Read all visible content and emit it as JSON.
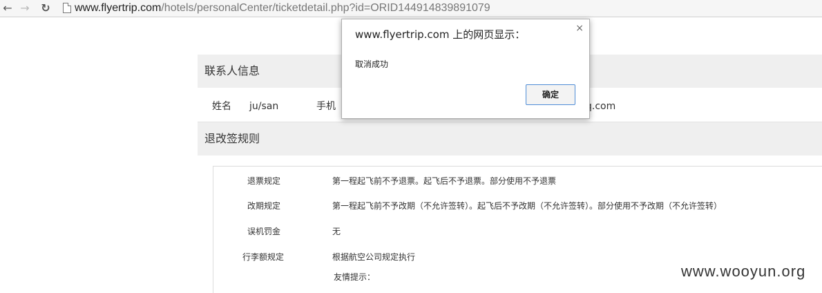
{
  "browser": {
    "url_host": "www.flyertrip.com",
    "url_path": "/hotels/personalCenter/ticketdetail.php?id=ORID144914839891079"
  },
  "contact": {
    "header": "联系人信息",
    "name_label": "姓名",
    "name_value": "ju/san",
    "phone_label": "手机",
    "email_partial": "q.com"
  },
  "rules": {
    "header": "退改签规则",
    "items": [
      {
        "label": "退票规定",
        "value": "第一程起飞前不予退票。起飞后不予退票。部分使用不予退票"
      },
      {
        "label": "改期规定",
        "value": "第一程起飞前不予改期（不允许签转）。起飞后不予改期（不允许签转）。部分使用不予改期（不允许签转）"
      },
      {
        "label": "误机罚金",
        "value": "无"
      },
      {
        "label": "行李额规定",
        "value": "根据航空公司规定执行"
      }
    ],
    "tip": "友情提示："
  },
  "dialog": {
    "title": "www.flyertrip.com 上的网页显示：",
    "close": "×",
    "message": "取消成功",
    "ok_label": "确定"
  },
  "watermark": "www.wooyun.org"
}
